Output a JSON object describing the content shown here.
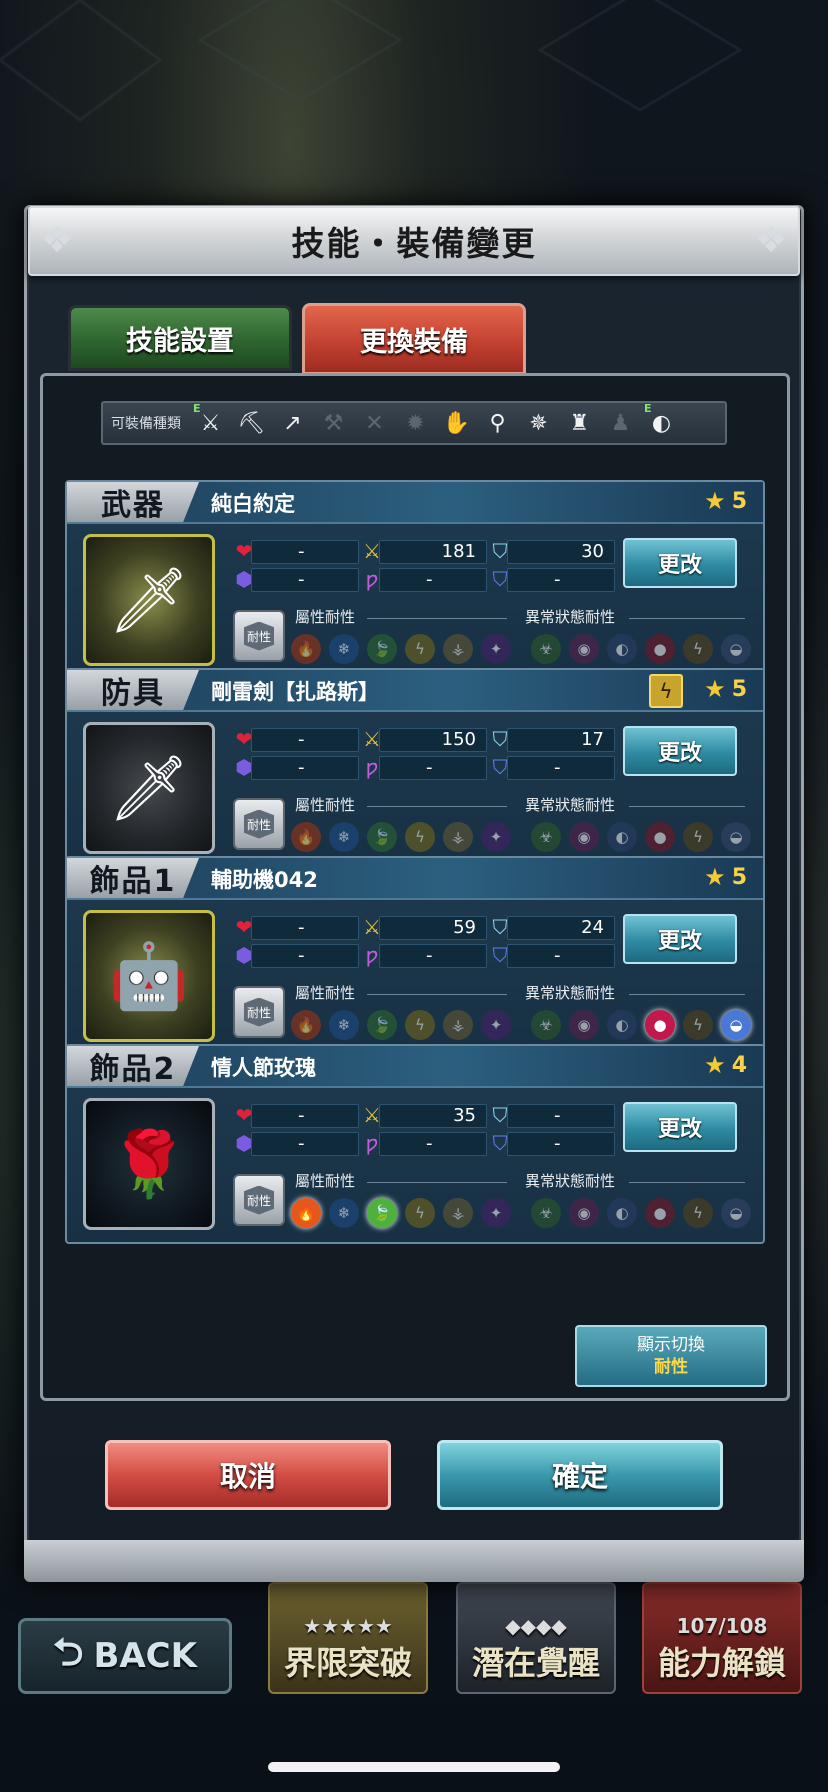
{
  "dialog": {
    "title": "技能・裝備變更"
  },
  "tabs": {
    "skill": "技能設置",
    "equip": "更換裝備"
  },
  "types_bar": {
    "label": "可裝備種類",
    "icons": [
      "sword-e-icon",
      "axe-icon",
      "spear-icon",
      "hammer-icon",
      "dual-blade-icon",
      "gear-icon",
      "claw-icon",
      "staff-icon",
      "heavy-armor-icon",
      "clothing-icon",
      "robe-icon",
      "accessory-e-icon"
    ],
    "e_mark": "E"
  },
  "colors": {
    "accent": "#f8d24a",
    "cancel": "#d34d44",
    "confirm": "#3a98ac"
  },
  "section_labels": {
    "attr": "屬性耐性",
    "status": "異常狀態耐性",
    "resist_btn": "耐性",
    "change": "更改"
  },
  "equipment": [
    {
      "slot": "武器",
      "name": "純白約定",
      "rarity": "5",
      "hp": "-",
      "atk": "181",
      "def": "30",
      "mp": "-",
      "matk": "-",
      "mdef": "-"
    },
    {
      "slot": "防具",
      "name": "剛雷劍【扎路斯】",
      "rarity": "5",
      "hp": "-",
      "atk": "150",
      "def": "17",
      "mp": "-",
      "matk": "-",
      "mdef": "-"
    },
    {
      "slot": "飾品1",
      "name": "輔助機042",
      "rarity": "5",
      "hp": "-",
      "atk": "59",
      "def": "24",
      "mp": "-",
      "matk": "-",
      "mdef": "-",
      "notes": [
        "耐性",
        "耐性"
      ]
    },
    {
      "slot": "飾品2",
      "name": "情人節玫瑰",
      "rarity": "4",
      "hp": "-",
      "atk": "35",
      "def": "-",
      "mp": "-",
      "matk": "-",
      "mdef": "-"
    }
  ],
  "toggle": {
    "line1": "顯示切換",
    "line2": "耐性"
  },
  "buttons": {
    "cancel": "取消",
    "confirm": "確定"
  },
  "underlying": {
    "back": "BACK",
    "limit_break": "界限突破",
    "awaken": "潛在覺醒",
    "unlock": "能力解鎖",
    "unlock_count": "107/108"
  }
}
